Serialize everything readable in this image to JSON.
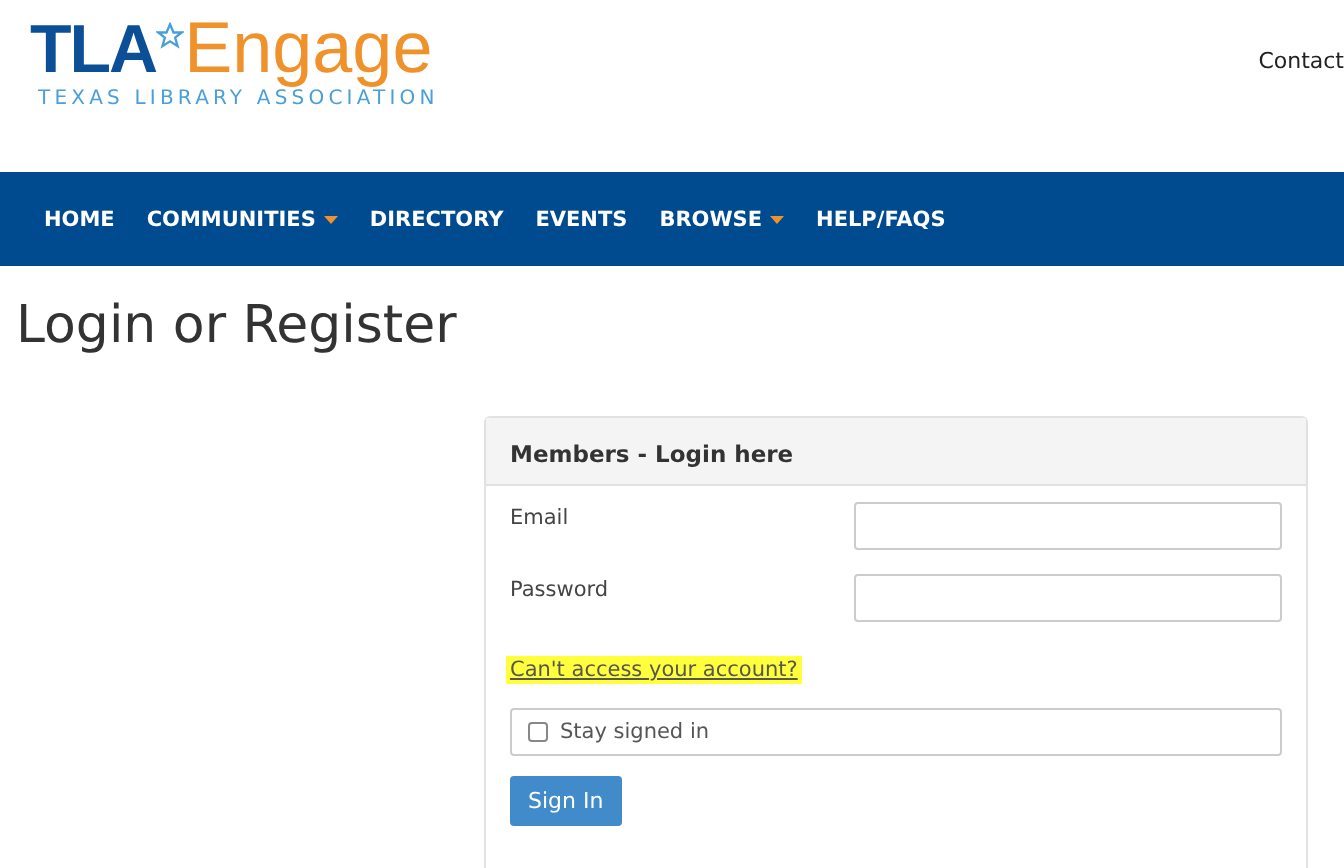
{
  "logo": {
    "mark": "TLA",
    "name": "Engage",
    "subtitle": "TEXAS LIBRARY ASSOCIATION"
  },
  "header_link": "Contact",
  "nav": [
    {
      "label": "HOME",
      "dropdown": false
    },
    {
      "label": "COMMUNITIES",
      "dropdown": true
    },
    {
      "label": "DIRECTORY",
      "dropdown": false
    },
    {
      "label": "EVENTS",
      "dropdown": false
    },
    {
      "label": "BROWSE",
      "dropdown": true
    },
    {
      "label": "HELP/FAQS",
      "dropdown": false
    }
  ],
  "page_title": "Login or Register",
  "login_panel": {
    "title": "Members - Login here",
    "fields": [
      {
        "label": "Email"
      },
      {
        "label": "Password"
      }
    ],
    "help_link": {
      "text": "Can't access your account?",
      "highlighted": true
    },
    "stay_signed_in": {
      "label": "Stay signed in",
      "checked": false
    },
    "submit": "Sign In"
  }
}
